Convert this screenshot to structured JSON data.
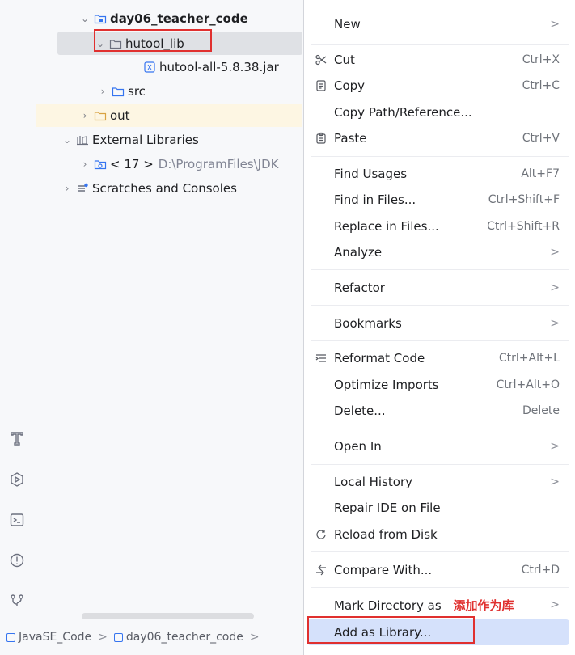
{
  "project_tree": {
    "project_name": "day06_teacher_code",
    "folder_selected": "hutool_lib",
    "jar_file": "hutool-all-5.8.38.jar",
    "src_folder": "src",
    "out_folder": "out",
    "external_libraries": "External Libraries",
    "jdk_item": "< 17 >",
    "jdk_path": "D:\\ProgramFiles\\JDK",
    "scratches": "Scratches and Consoles"
  },
  "status_bar": {
    "breadcrumbs": [
      "JavaSE_Code",
      "day06_teacher_code"
    ],
    "separator": ">"
  },
  "context_menu": {
    "items": [
      {
        "label": "New",
        "shortcut": "",
        "submenu": true
      },
      {
        "label": "Cut",
        "shortcut": "Ctrl+X",
        "icon": "scissors-icon"
      },
      {
        "label": "Copy",
        "shortcut": "Ctrl+C",
        "icon": "copy-icon"
      },
      {
        "label": "Copy Path/Reference...",
        "shortcut": ""
      },
      {
        "label": "Paste",
        "shortcut": "Ctrl+V",
        "icon": "paste-icon"
      },
      {
        "label": "Find Usages",
        "shortcut": "Alt+F7"
      },
      {
        "label": "Find in Files...",
        "shortcut": "Ctrl+Shift+F"
      },
      {
        "label": "Replace in Files...",
        "shortcut": "Ctrl+Shift+R"
      },
      {
        "label": "Analyze",
        "shortcut": "",
        "submenu": true
      },
      {
        "label": "Refactor",
        "shortcut": "",
        "submenu": true
      },
      {
        "label": "Bookmarks",
        "shortcut": "",
        "submenu": true
      },
      {
        "label": "Reformat Code",
        "shortcut": "Ctrl+Alt+L",
        "icon": "reformat-icon"
      },
      {
        "label": "Optimize Imports",
        "shortcut": "Ctrl+Alt+O"
      },
      {
        "label": "Delete...",
        "shortcut": "Delete"
      },
      {
        "label": "Open In",
        "shortcut": "",
        "submenu": true
      },
      {
        "label": "Local History",
        "shortcut": "",
        "submenu": true
      },
      {
        "label": "Repair IDE on File",
        "shortcut": ""
      },
      {
        "label": "Reload from Disk",
        "shortcut": "",
        "icon": "reload-icon"
      },
      {
        "label": "Compare With...",
        "shortcut": "Ctrl+D",
        "icon": "compare-icon"
      },
      {
        "label": "Mark Directory as",
        "shortcut": "",
        "submenu": true
      },
      {
        "label": "Add as Library...",
        "shortcut": "",
        "highlighted": true
      }
    ],
    "annotation": "添加作为库",
    "submenu_arrow": ">"
  },
  "colors": {
    "accent": "#3574f0",
    "highlight_box": "#e0302f",
    "selection_bg": "#dfe1e5",
    "menu_highlight": "#d5e1fb"
  }
}
